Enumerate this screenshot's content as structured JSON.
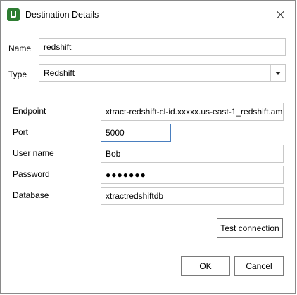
{
  "window": {
    "title": "Destination Details",
    "app_icon": "ui-logo-icon",
    "close_icon": "close-icon"
  },
  "name": {
    "label": "Name",
    "value": "redshift"
  },
  "type": {
    "label": "Type",
    "value": "Redshift"
  },
  "endpoint": {
    "label": "Endpoint",
    "value": "xtract-redshift-cl-id.xxxxx.us-east-1_redshift.am"
  },
  "port": {
    "label": "Port",
    "value": "5000"
  },
  "username": {
    "label": "User name",
    "value": "Bob"
  },
  "password": {
    "label": "Password",
    "value": "●●●●●●●"
  },
  "database": {
    "label": "Database",
    "value": "xtractredshiftdb"
  },
  "buttons": {
    "test": "Test connection",
    "ok": "OK",
    "cancel": "Cancel"
  },
  "colors": {
    "focus_border": "#4a7fbf",
    "icon_green": "#2e7d32"
  }
}
